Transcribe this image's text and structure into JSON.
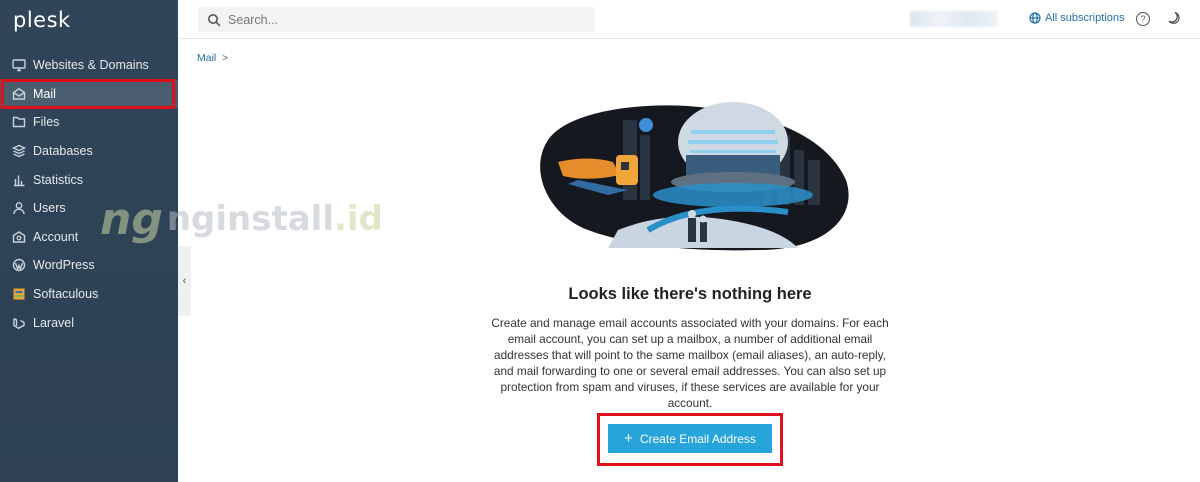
{
  "app": {
    "logo": "plesk"
  },
  "sidebar": {
    "items": [
      {
        "label": "Websites & Domains",
        "icon": "monitor-icon"
      },
      {
        "label": "Mail",
        "icon": "mail-icon",
        "active": true
      },
      {
        "label": "Files",
        "icon": "folder-icon"
      },
      {
        "label": "Databases",
        "icon": "database-icon"
      },
      {
        "label": "Statistics",
        "icon": "bar-chart-icon"
      },
      {
        "label": "Users",
        "icon": "user-icon"
      },
      {
        "label": "Account",
        "icon": "account-icon"
      },
      {
        "label": "WordPress",
        "icon": "wordpress-icon"
      },
      {
        "label": "Softaculous",
        "icon": "softaculous-icon"
      },
      {
        "label": "Laravel",
        "icon": "laravel-icon"
      }
    ]
  },
  "topbar": {
    "search_placeholder": "Search...",
    "subscriptions_label": "All subscriptions",
    "help_label": "?"
  },
  "breadcrumb": {
    "item": "Mail",
    "separator": ">"
  },
  "watermark": {
    "logo": "ng",
    "text": "nginstall",
    "tld": ".id"
  },
  "empty_state": {
    "title": "Looks like there's nothing here",
    "description": "Create and manage email accounts associated with your domains. For each email account, you can set up a mailbox, a number of additional email addresses that will point to the same mailbox (email aliases), an auto-reply, and mail forwarding to one or several email addresses. You can also set up protection from spam and viruses, if these services are available for your account.",
    "button_label": "Create Email Address",
    "button_plus": "+"
  },
  "colors": {
    "sidebar_bg": "#2f4050",
    "accent": "#27a4da",
    "link": "#1f6fa8",
    "highlight": "#e0101a"
  }
}
